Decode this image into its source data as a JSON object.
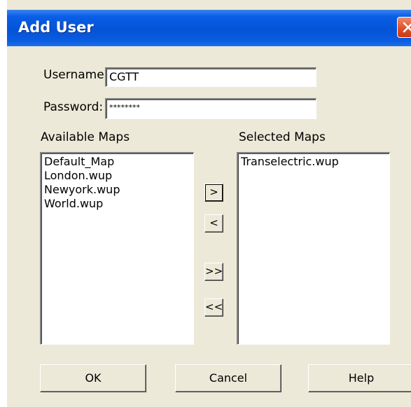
{
  "window": {
    "title": "Add User"
  },
  "form": {
    "username_label": "Username:",
    "username_value": "CGTT",
    "password_label": "Password:",
    "password_value": "********"
  },
  "available": {
    "label": "Available Maps",
    "items": [
      "Default_Map",
      "London.wup",
      "Newyork.wup",
      "World.wup"
    ]
  },
  "selected": {
    "label": "Selected Maps",
    "items": [
      "Transelectric.wup"
    ]
  },
  "transfer": {
    "add_label": ">",
    "remove_label": "<",
    "add_all_label": ">>",
    "remove_all_label": "<<"
  },
  "buttons": {
    "ok": "OK",
    "cancel": "Cancel",
    "help": "Help"
  },
  "colors": {
    "titlebar": "#0353d6",
    "dialog_bg": "#ece9d8",
    "close_button": "#e0502a"
  },
  "icons": {
    "close": "close-icon"
  }
}
